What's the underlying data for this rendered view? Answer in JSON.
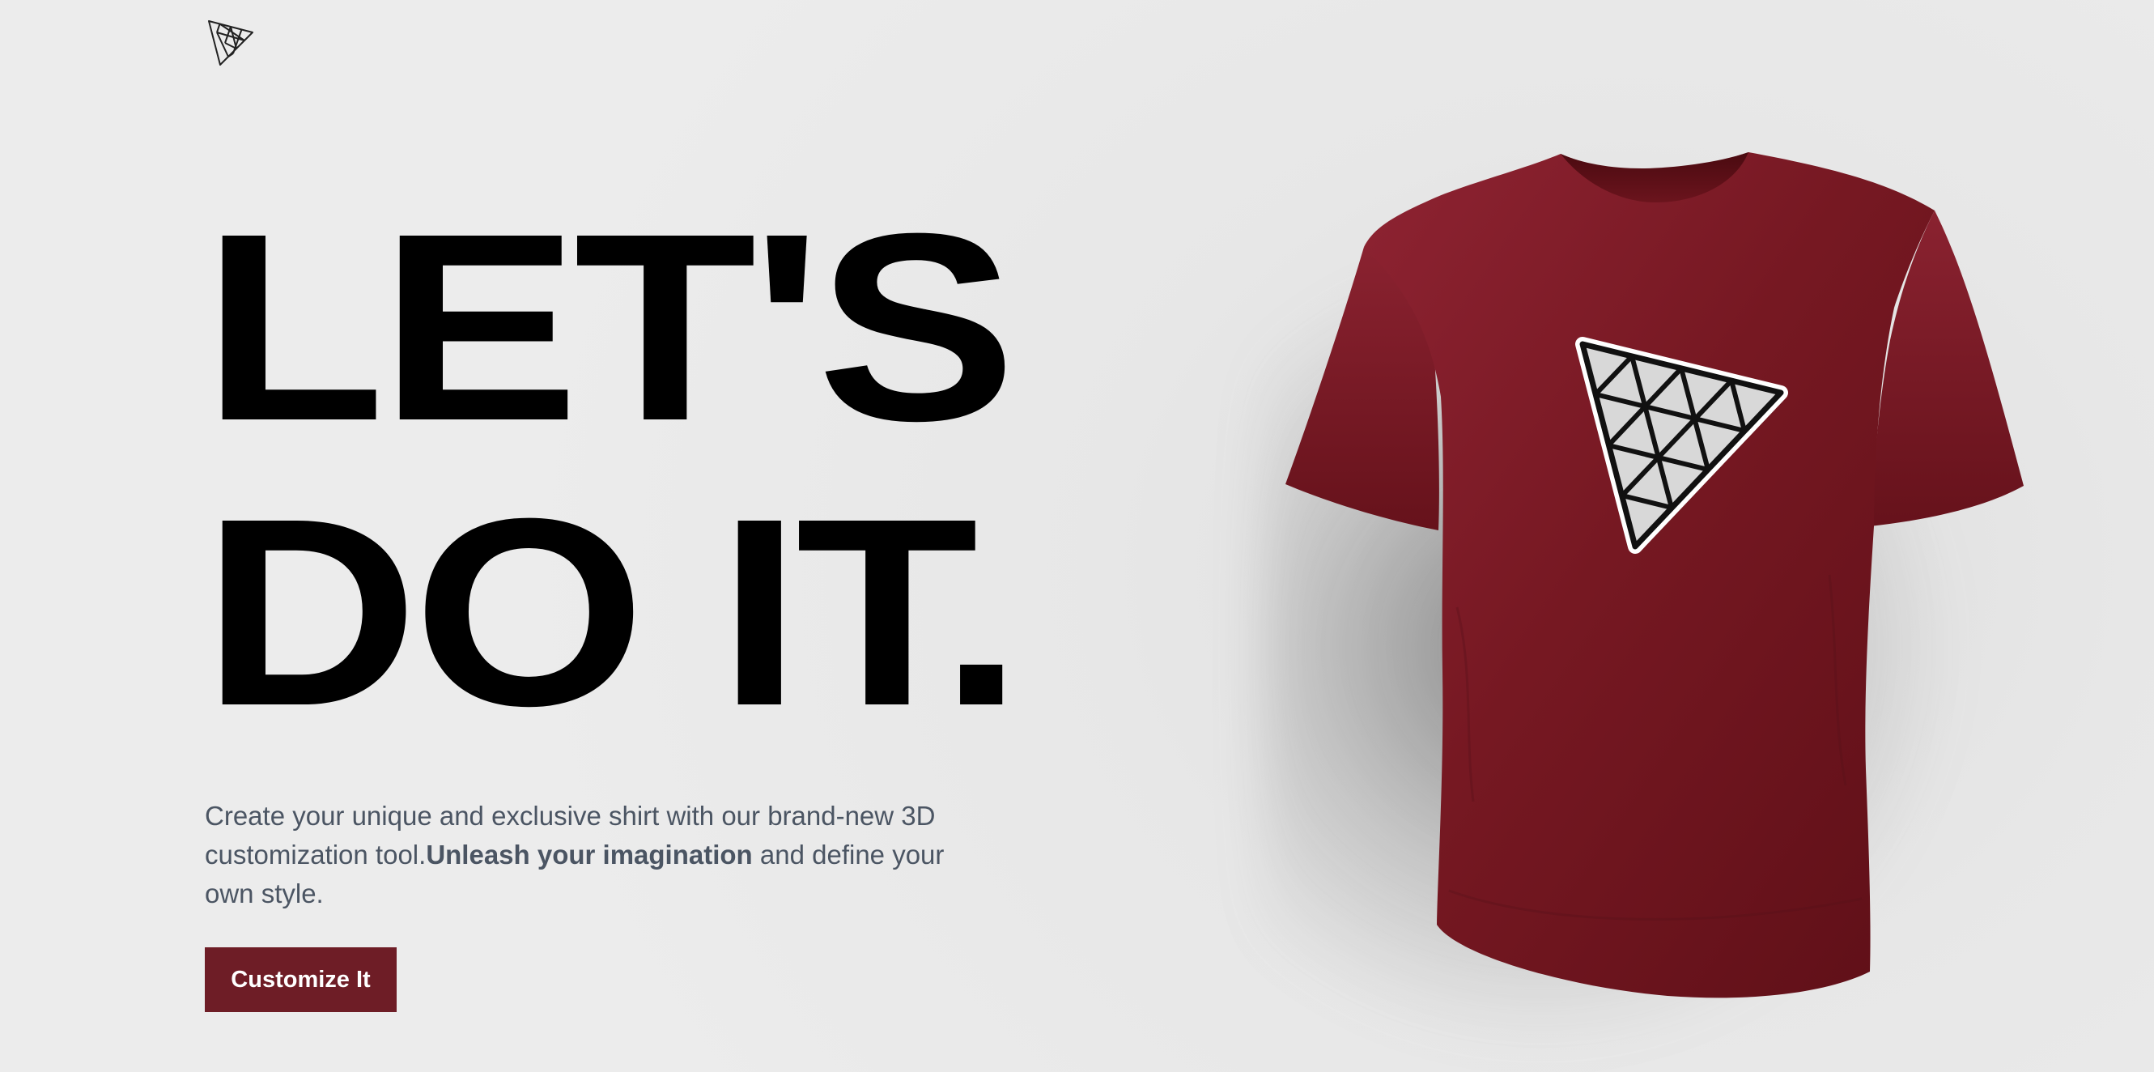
{
  "header": {
    "logo_icon": "triangle-mesh-logo-icon"
  },
  "hero": {
    "title_line1": "LET'S",
    "title_line2": "DO IT.",
    "description_part1": "Create your unique and exclusive shirt with our brand-new 3D customization tool.",
    "description_bold": "Unleash your imagination",
    "description_part2": " and define your own style.",
    "cta_label": "Customize It"
  },
  "product": {
    "name": "t-shirt",
    "shirt_color": "#8b1e2b",
    "decal_icon": "triangle-mesh-decal-icon"
  },
  "colors": {
    "accent": "#6e1d26",
    "text": "#000000",
    "muted_text": "#4b5563",
    "background": "#e9e9e9"
  }
}
